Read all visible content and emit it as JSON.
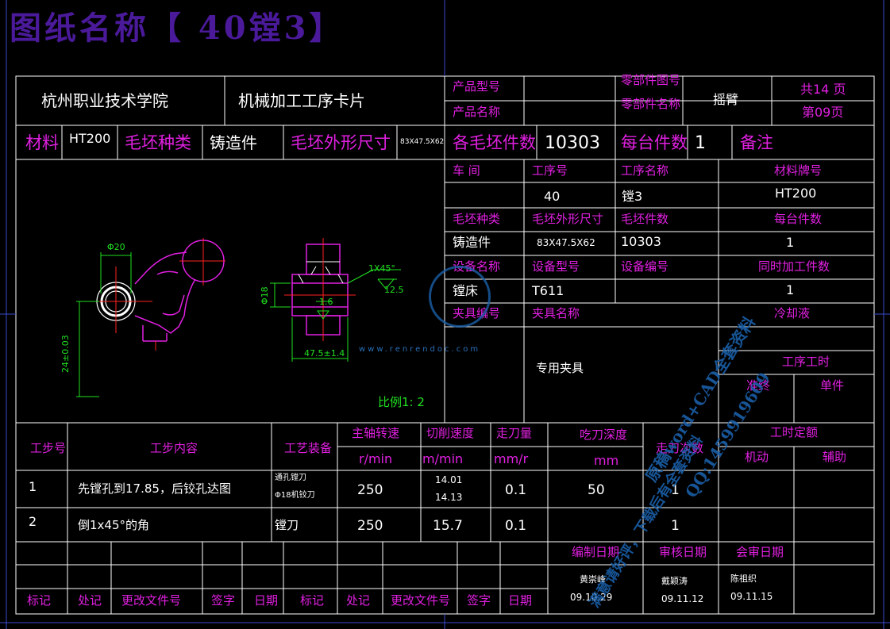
{
  "title": "图纸名称【 40镗3】",
  "header": {
    "school": "杭州职业技术学院",
    "card": "机械加工工序卡片",
    "product_model_label": "产品型号",
    "product_name_label": "产品名称",
    "part_no_label": "零部件图号",
    "part_name_label": "零部件名称",
    "part_name": "摇臂",
    "total_pages": "共14 页",
    "page_no": "第09页"
  },
  "material_row": {
    "material_label": "材料",
    "material": "HT200",
    "blank_type_label": "毛坯种类",
    "blank_type": "铸造件",
    "blank_size_label": "毛坯外形尺寸",
    "blank_size": "83X47.5X62",
    "pieces_per_blank_label": "各毛坯件数",
    "pieces_per_blank": "10303",
    "per_unit_label": "每台件数",
    "per_unit": "1",
    "remark_label": "备注"
  },
  "process_info": {
    "workshop_label": "车  间",
    "op_no_label": "工序号",
    "op_name_label": "工序名称",
    "mat_grade_label": "材料牌号",
    "op_no": "40",
    "op_name": "镗3",
    "mat_grade": "HT200",
    "blank_type_label": "毛坯种类",
    "blank_size_label": "毛坯外形尺寸",
    "blank_count_label": "毛坯件数",
    "per_unit_label": "每台件数",
    "blank_type": "铸造件",
    "blank_size": "83X47.5X62",
    "blank_count": "10303",
    "per_unit": "1",
    "equip_name_label": "设备名称",
    "equip_model_label": "设备型号",
    "equip_no_label": "设备编号",
    "simul_label": "同时加工件数",
    "equip_name": "镗床",
    "equip_model": "T611",
    "simul": "1",
    "fixture_no_label": "夹具编号",
    "fixture_name_label": "夹具名称",
    "coolant_label": "冷却液",
    "fixture_name": "专用夹具",
    "op_time_label": "工序工时",
    "quasi_label": "准终",
    "unit_label": "单件"
  },
  "drawing": {
    "dim_dia20": "Φ20",
    "dim_24": "24±0.03",
    "dim_chamfer": "1X45°",
    "dim_ra125": "12.5",
    "dim_dia18": "Φ18",
    "dim_ra16": "1.6",
    "dim_475": "47.5±1.4",
    "scale": "比例1: 2"
  },
  "steps": {
    "h_step_no": "工步号",
    "h_content": "工步内容",
    "h_equip": "工艺装备",
    "h_speed": "主轴转速",
    "h_speed_unit": "r/min",
    "h_cut_speed": "切削速度",
    "h_cut_unit": "m/min",
    "h_feed": "走刀量",
    "h_feed_unit": "mm/r",
    "h_depth": "吃刀深度",
    "h_depth_unit": "mm",
    "h_passes": "走刀次数",
    "h_time": "工时定额",
    "h_machine": "机动",
    "h_aux": "辅助",
    "rows": [
      {
        "no": "1",
        "content": "先镗孔到17.85，后铰孔达图",
        "equip1": "通孔镗刀",
        "equip2": "Φ18机铰刀",
        "speed": "250",
        "cut1": "14.01",
        "cut2": "14.13",
        "feed": "0.1",
        "depth": "50",
        "passes": "1"
      },
      {
        "no": "2",
        "content": "倒1x45°的角",
        "equip1": "镗刀",
        "equip2": "",
        "speed": "250",
        "cut1": "15.7",
        "cut2": "",
        "feed": "0.1",
        "depth": "",
        "passes": "1"
      }
    ]
  },
  "footer": {
    "compile_label": "编制日期",
    "review_label": "审核日期",
    "sign_label": "会审日期",
    "compiler": "黄崇峰",
    "compile_date": "09.10.29",
    "reviewer": "戴颖涛",
    "review_date": "09.11.12",
    "signer": "陈祖织",
    "sign_date": "09.11.15",
    "mark": "标记",
    "place": "处记",
    "change_doc": "更改文件号",
    "signature": "签字",
    "date": "日期"
  },
  "watermark": {
    "site": "www.renrendoc.com",
    "line1": "原稿word+CAD全套资料",
    "line2": "QQ:1459919609",
    "line3": "满意请好评，下载后有全套资料"
  }
}
